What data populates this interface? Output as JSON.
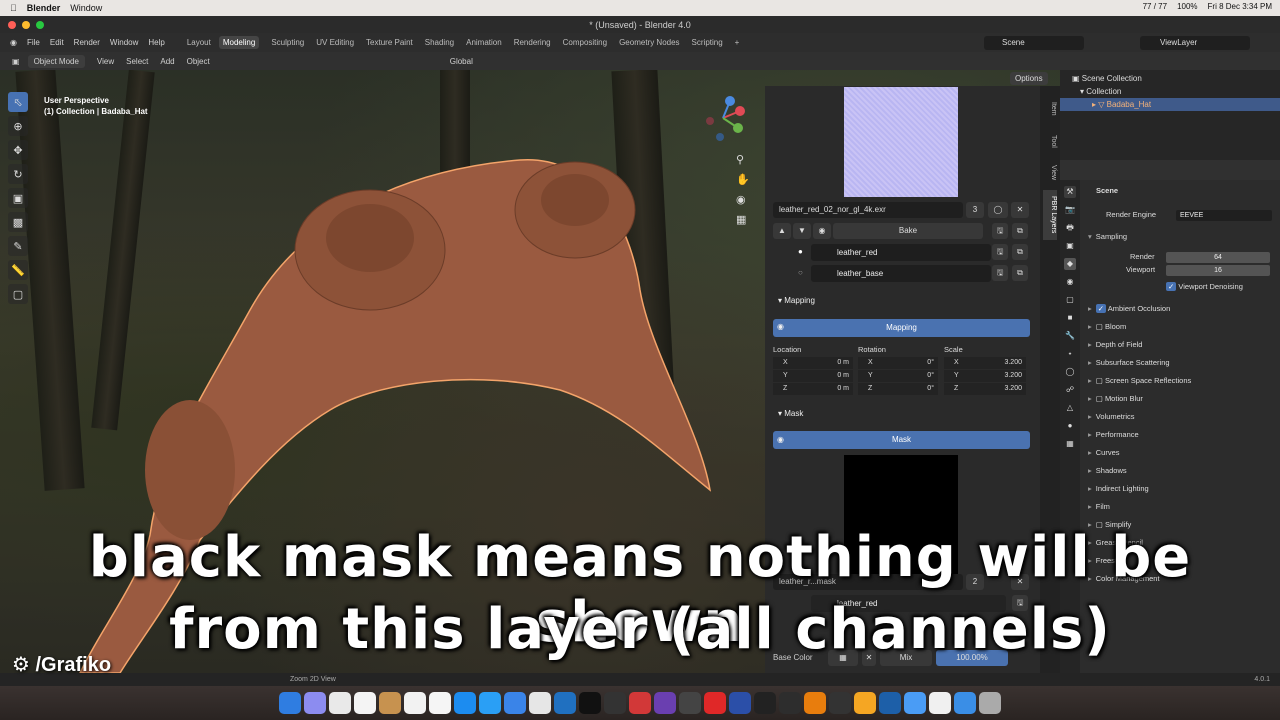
{
  "macos_menubar": {
    "app": "Blender",
    "menu": "Window",
    "battery_counter": "77 / 77",
    "battery": "100%",
    "date": "Fri 8 Dec 3:34 PM"
  },
  "window": {
    "title": "* (Unsaved) - Blender 4.0"
  },
  "menus": [
    "File",
    "Edit",
    "Render",
    "Window",
    "Help"
  ],
  "workspaces": [
    "Layout",
    "Modeling",
    "Sculpting",
    "UV Editing",
    "Texture Paint",
    "Shading",
    "Animation",
    "Rendering",
    "Compositing",
    "Geometry Nodes",
    "Scripting"
  ],
  "active_workspace": "Modeling",
  "scene": "Scene",
  "view_layer": "ViewLayer",
  "viewport_header": {
    "mode": "Object Mode",
    "view": "View",
    "select": "Select",
    "add": "Add",
    "object": "Object",
    "orientation": "Global",
    "options": "Options"
  },
  "viewport": {
    "perspective": "User Perspective",
    "collection": "(1) Collection | Badaba_Hat"
  },
  "npanel_tabs": [
    "Item",
    "Tool",
    "View",
    "PBR Layers"
  ],
  "npanel": {
    "texture_name": "leather_red_02_nor_gl_4k.exr",
    "texture_users": "3",
    "bake_label": "Bake",
    "layers": [
      "leather_red",
      "leather_base"
    ],
    "mapping_section": "Mapping",
    "mapping_button": "Mapping",
    "columns": [
      "Location",
      "Rotation",
      "Scale"
    ],
    "axes": [
      "X",
      "Y",
      "Z"
    ],
    "location": [
      "0 m",
      "0 m",
      "0 m"
    ],
    "rotation": [
      "0°",
      "0°",
      "0°"
    ],
    "scale": [
      "3.200",
      "3.200",
      "3.200"
    ],
    "mask_section": "Mask",
    "mask_button": "Mask",
    "mask_layer_name": "leather_red",
    "partial_mask_text": "leather_r...mask",
    "partial_mask_count": "2",
    "base_color_label": "Base Color",
    "blend_mode": "Mix",
    "opacity": "100.00%"
  },
  "outliner": {
    "root": "Scene Collection",
    "collection": "Collection",
    "object": "Badaba_Hat"
  },
  "properties": {
    "scene_label": "Scene",
    "render_engine_label": "Render Engine",
    "render_engine": "EEVEE",
    "sampling": "Sampling",
    "render_label": "Render",
    "render_value": "64",
    "viewport_label": "Viewport",
    "viewport_value": "16",
    "viewport_denoising": "Viewport Denoising",
    "panels": [
      "Ambient Occlusion",
      "Bloom",
      "Depth of Field",
      "Subsurface Scattering",
      "Screen Space Reflections",
      "Motion Blur",
      "Volumetrics",
      "Performance",
      "Curves",
      "Shadows",
      "Indirect Lighting",
      "Film",
      "Simplify",
      "Grease Pencil",
      "Freestyle",
      "Color Management"
    ]
  },
  "statusbar": {
    "hint": "Zoom 2D View",
    "version": "4.0.1"
  },
  "subtitles": {
    "line1": "black mask means nothing will be shown",
    "line2": "from this layer (all channels)"
  },
  "watermark": "/Grafiko",
  "colors": {
    "accent_blue": "#4772b3",
    "selection_outline": "#f4a46a",
    "hat": "#9a5a40"
  }
}
